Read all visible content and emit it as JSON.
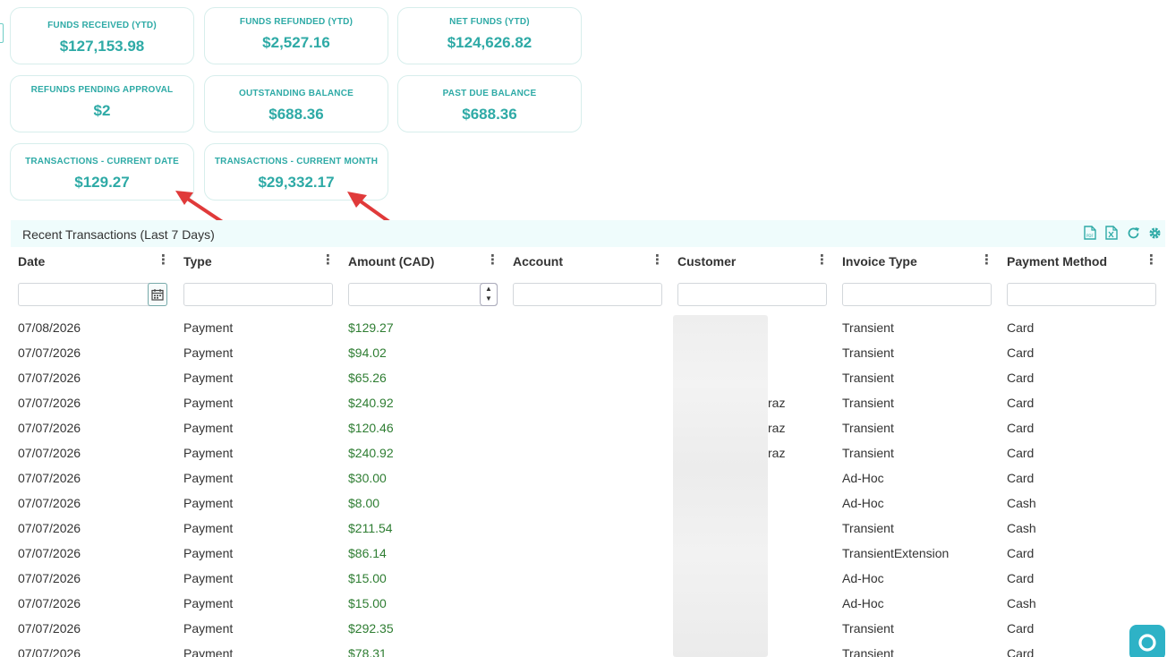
{
  "summary_cards": [
    {
      "label": "FUNDS RECEIVED (YTD)",
      "value": "$127,153.98"
    },
    {
      "label": "FUNDS REFUNDED (YTD)",
      "value": "$2,527.16"
    },
    {
      "label": "NET FUNDS (YTD)",
      "value": "$124,626.82"
    },
    {
      "label": "REFUNDS PENDING APPROVAL",
      "value": "$2"
    },
    {
      "label": "OUTSTANDING BALANCE",
      "value": "$688.36"
    },
    {
      "label": "PAST DUE BALANCE",
      "value": "$688.36"
    },
    {
      "label": "TRANSACTIONS - CURRENT DATE",
      "value": "$129.27"
    },
    {
      "label": "TRANSACTIONS - CURRENT MONTH",
      "value": "$29,332.17"
    }
  ],
  "grid": {
    "title": "Recent Transactions (Last 7 Days)",
    "tools": [
      "pdf-export-icon",
      "excel-export-icon",
      "refresh-icon",
      "settings-icon"
    ],
    "columns": [
      "Date",
      "Type",
      "Amount (CAD)",
      "Account",
      "Customer",
      "Invoice Type",
      "Payment Method"
    ],
    "rows": [
      [
        "07/08/2026",
        "Payment",
        "$129.27",
        "",
        "",
        "Transient",
        "Card"
      ],
      [
        "07/07/2026",
        "Payment",
        "$94.02",
        "",
        "",
        "Transient",
        "Card"
      ],
      [
        "07/07/2026",
        "Payment",
        "$65.26",
        "",
        "",
        "Transient",
        "Card"
      ],
      [
        "07/07/2026",
        "Payment",
        "$240.92",
        "",
        "raz",
        "Transient",
        "Card"
      ],
      [
        "07/07/2026",
        "Payment",
        "$120.46",
        "",
        "raz",
        "Transient",
        "Card"
      ],
      [
        "07/07/2026",
        "Payment",
        "$240.92",
        "",
        "raz",
        "Transient",
        "Card"
      ],
      [
        "07/07/2026",
        "Payment",
        "$30.00",
        "",
        "",
        "Ad-Hoc",
        "Card"
      ],
      [
        "07/07/2026",
        "Payment",
        "$8.00",
        "",
        "",
        "Ad-Hoc",
        "Cash"
      ],
      [
        "07/07/2026",
        "Payment",
        "$211.54",
        "",
        "",
        "Transient",
        "Cash"
      ],
      [
        "07/07/2026",
        "Payment",
        "$86.14",
        "",
        "",
        "TransientExtension",
        "Card"
      ],
      [
        "07/07/2026",
        "Payment",
        "$15.00",
        "",
        "",
        "Ad-Hoc",
        "Card"
      ],
      [
        "07/07/2026",
        "Payment",
        "$15.00",
        "",
        "",
        "Ad-Hoc",
        "Cash"
      ],
      [
        "07/07/2026",
        "Payment",
        "$292.35",
        "",
        "",
        "Transient",
        "Card"
      ],
      [
        "07/07/2026",
        "Payment",
        "$78.31",
        "",
        "",
        "Transient",
        "Card"
      ]
    ]
  },
  "colors": {
    "accent": "#2eaaa6",
    "amount": "#2e7d32",
    "arrow": "#e03a3a",
    "bar_bg": "#effcfc"
  }
}
